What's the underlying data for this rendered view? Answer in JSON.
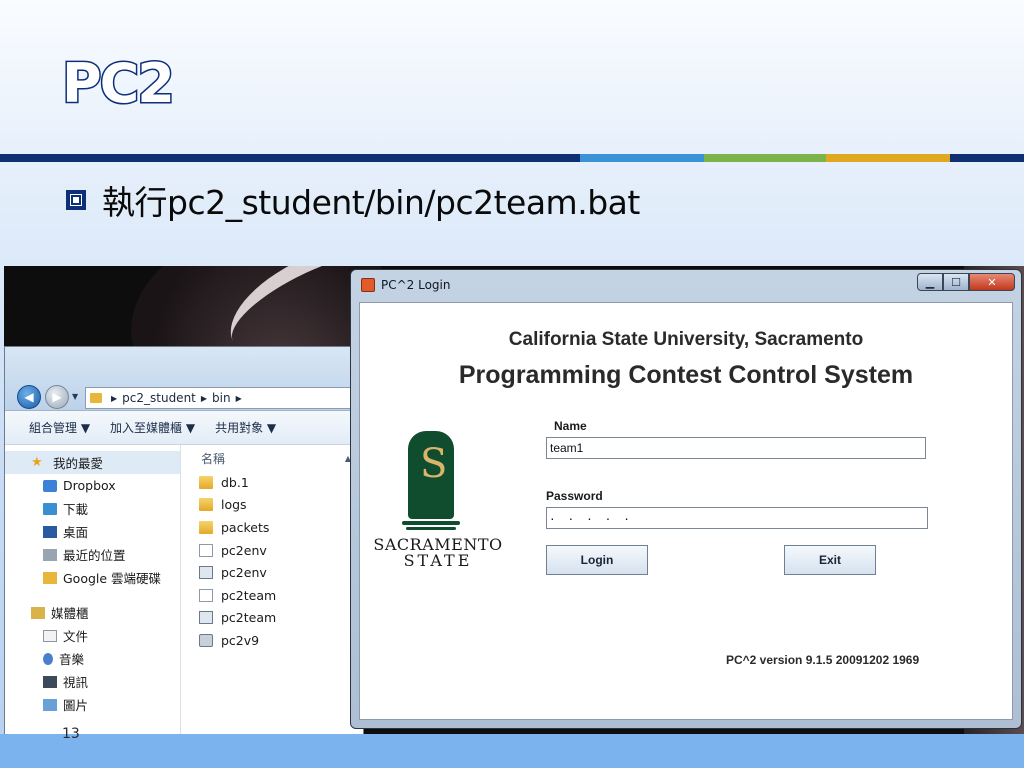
{
  "slide": {
    "title": "PC2",
    "bullet": "執行pc2_student/bin/pc2team.bat",
    "page_number": "13"
  },
  "explorer": {
    "breadcrumb": [
      "pc2_student",
      "bin"
    ],
    "toolbar": [
      "組合管理 ▼",
      "加入至媒體櫃 ▼",
      "共用對象 ▼"
    ],
    "nav": {
      "favorites": "我的最愛",
      "fav_items": [
        "Dropbox",
        "下載",
        "桌面",
        "最近的位置",
        "Google 雲端硬碟"
      ],
      "libraries": "媒體櫃",
      "lib_items": [
        "文件",
        "音樂",
        "視訊",
        "圖片"
      ]
    },
    "column_header": "名稱",
    "files": [
      {
        "name": "db.1",
        "icon": "folder-icon"
      },
      {
        "name": "logs",
        "icon": "folder-icon"
      },
      {
        "name": "packets",
        "icon": "folder-icon"
      },
      {
        "name": "pc2env",
        "icon": "file-icon"
      },
      {
        "name": "pc2env",
        "icon": "batch-file-icon"
      },
      {
        "name": "pc2team",
        "icon": "file-icon"
      },
      {
        "name": "pc2team",
        "icon": "batch-file-icon"
      },
      {
        "name": "pc2v9",
        "icon": "jar-file-icon"
      }
    ]
  },
  "dialog": {
    "title": "PC^2 Login",
    "university": "California State University, Sacramento",
    "system_name": "Programming Contest Control System",
    "logo": {
      "line1": "SACRAMENTO",
      "line2": "STATE",
      "glyph": "S"
    },
    "name_label": "Name",
    "name_value": "team1",
    "password_label": "Password",
    "password_value": "· · · · ·",
    "login_label": "Login",
    "exit_label": "Exit",
    "version": "PC^2 version 9.1.5 20091202 1969"
  },
  "colors": {
    "title_outline": "#0b2f7a",
    "rule": "#102f73",
    "accent_blue": "#3a93d6",
    "accent_green": "#7cb34a",
    "accent_gold": "#e0a81e",
    "csus_green": "#0f4d2e"
  }
}
